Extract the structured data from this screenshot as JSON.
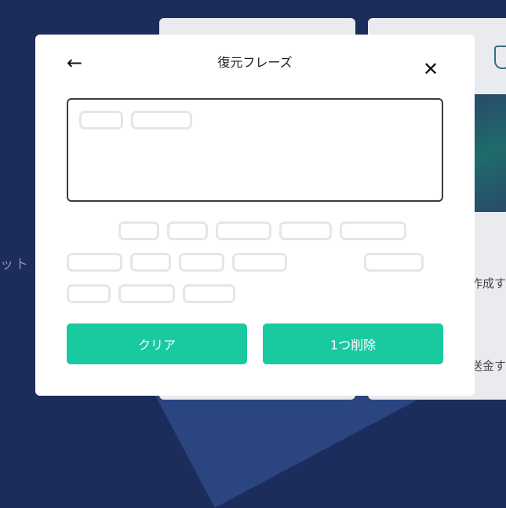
{
  "modal": {
    "title": "復元フレーズ",
    "back_icon": "←",
    "close_icon": "✕",
    "clear_label": "クリア",
    "delete_label": "1つ削除"
  },
  "background": {
    "left_text": "ット",
    "right_text_1": "作成す",
    "right_text_2": "送金す"
  }
}
